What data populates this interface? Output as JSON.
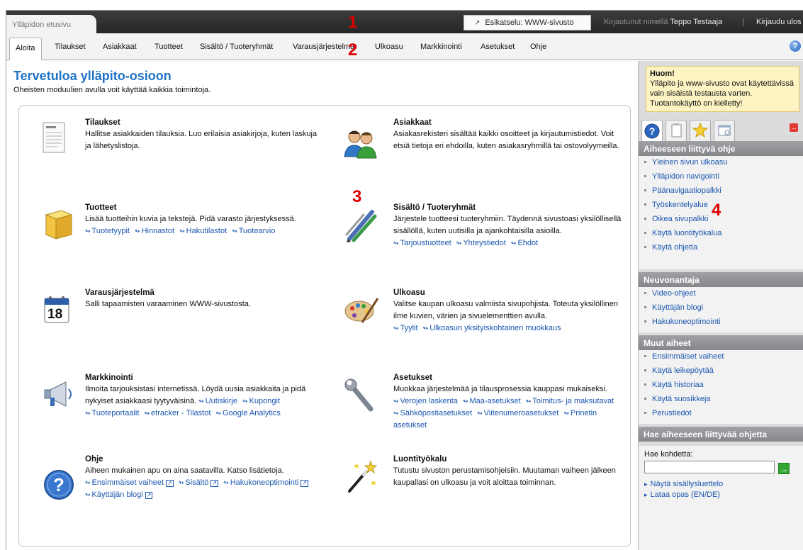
{
  "header": {
    "home_tab": "Ylläpidon etusivu",
    "preview_label": "Esikatselu: WWW-sivusto",
    "logged_in_prefix": "Kirjautunut nimellä",
    "user_name": "Teppo Testaaja",
    "separator": "|",
    "logout": "Kirjaudu ulos"
  },
  "nav": {
    "items": [
      "Aloita",
      "Tilaukset",
      "Asiakkaat",
      "Tuotteet",
      "Sisältö / Tuoteryhmät",
      "Varausjärjestelmä",
      "Ulkoasu",
      "Markkinointi",
      "Asetukset",
      "Ohje"
    ],
    "active": "Aloita"
  },
  "annotations": [
    "1",
    "2",
    "3",
    "4"
  ],
  "page": {
    "title": "Tervetuloa ylläpito-osioon",
    "subtitle": "Oheisten moduulien avulla voit käyttää kaikkia toimintoja."
  },
  "modules": {
    "orders": {
      "title": "Tilaukset",
      "desc": "Hallitse asiakkaiden tilauksia. Luo erilaisia asiakirjoja, kuten laskuja ja lähetyslistoja.",
      "icon": "document-icon"
    },
    "customers": {
      "title": "Asiakkaat",
      "desc": "Asiakasrekisteri sisältää kaikki osoitteet ja kirjautumistiedot. Voit etsiä tietoja eri ehdoilla, kuten asiakasryhmillä tai ostovolyymeilla.",
      "icon": "users-icon"
    },
    "products": {
      "title": "Tuotteet",
      "desc": "Lisää tuotteihin kuvia ja tekstejä. Pidä varasto järjestyksessä.",
      "links": [
        "Tuotetyypit",
        "Hinnastot",
        "Hakutilastot",
        "Tuotearvio"
      ],
      "icon": "box-icon"
    },
    "content": {
      "title": "Sisältö / Tuoteryhmät",
      "desc": "Järjestele tuotteesi tuoteryhmiin. Täydennä sivustoasi yksilöllisellä sisällöllä, kuten uutisilla ja ajankohtaisilla asioilla.",
      "links": [
        "Tarjoustuotteet",
        "Yhteystiedot",
        "Ehdot"
      ],
      "icon": "pens-icon"
    },
    "booking": {
      "title": "Varausjärjestelmä",
      "desc": "Salli tapaamisten varaaminen WWW-sivustosta.",
      "icon": "calendar-icon",
      "calendar_day": "18"
    },
    "layout": {
      "title": "Ulkoasu",
      "desc": "Valitse kaupan ulkoasu valmiista sivupohjista. Toteuta yksilöllinen ilme kuvien, värien ja sivuelementtien avulla.",
      "links": [
        "Tyylit",
        "Ulkoasun yksityiskohtainen muokkaus"
      ],
      "icon": "palette-icon"
    },
    "marketing": {
      "title": "Markkinointi",
      "desc": "Ilmoita tarjouksistasi internetissä. Löydä uusia asiakkaita ja pidä nykyiset asiakkaasi tyytyväisinä.",
      "inline_links": [
        "Uutiskirje",
        "Kupongit"
      ],
      "links": [
        "Tuoteportaalit",
        "etracker - Tilastot",
        "Google Analytics"
      ],
      "icon": "megaphone-icon"
    },
    "settings": {
      "title": "Asetukset",
      "desc": "Muokkaa järjestelmää ja tilausprosessia kauppasi mukaiseksi.",
      "links": [
        "Verojen laskenta",
        "Maa-asetukset",
        "Toimitus- ja maksutavat",
        "Sähköpostiasetukset",
        "Viitenumeroasetukset",
        "Prinetin asetukset"
      ],
      "icon": "wrench-icon"
    },
    "help": {
      "title": "Ohje",
      "desc": "Aiheen mukainen apu on aina saatavilla. Katso lisätietoja.",
      "links": [
        "Ensimmäiset vaiheet",
        "Sisältö",
        "Hakukoneoptimointi",
        "Käyttäjän blogi"
      ],
      "icon": "help-icon"
    },
    "wizard": {
      "title": "Luontityökalu",
      "desc": "Tutustu sivuston perustamisohjeisiin. Muutaman vaiheen jälkeen kaupallasi on ulkoasu ja voit aloittaa toiminnan.",
      "icon": "magic-wand-icon"
    }
  },
  "sidebar": {
    "note_title": "Huom!",
    "note_text": "Ylläpito ja www-sivusto ovat käytettävissä vain sisäistä testausta varten. Tuotantokäyttö on kielletty!",
    "tabs": [
      "help-icon",
      "notepad-icon",
      "star-icon",
      "window-icon"
    ],
    "sections": [
      {
        "title": "Aiheeseen liittyvä ohje",
        "items": [
          "Yleinen sivun ulkoasu",
          "Ylläpidon navigointi",
          "Päänavigaatiopalkki",
          "Työskentelyalue",
          "Oikea sivupalkki",
          "Käytä luontityökalua",
          "Käytä ohjetta"
        ]
      },
      {
        "title": "Neuvonantaja",
        "items": [
          "Video-ohjeet",
          "Käyttäjän blogi",
          "Hakukoneoptimointi"
        ]
      },
      {
        "title": "Muut aiheet",
        "items": [
          "Ensimmäiset vaiheet",
          "Käytä leikepöytää",
          "Käytä historiaa",
          "Käytä suosikkeja",
          "Perustiedot"
        ]
      }
    ],
    "search": {
      "title": "Hae aiheeseen liittyvää ohjetta",
      "label": "Hae kohdetta:",
      "value": "",
      "links": [
        "Näytä sisällysluettelo",
        "Lataa opas (EN/DE)"
      ]
    }
  },
  "colors": {
    "title_blue": "#1f73c7",
    "link_blue": "#1a56b0",
    "annotation_red": "#e00000",
    "note_bg": "#fdf3c3",
    "sidebar_header": "#8f9194"
  }
}
